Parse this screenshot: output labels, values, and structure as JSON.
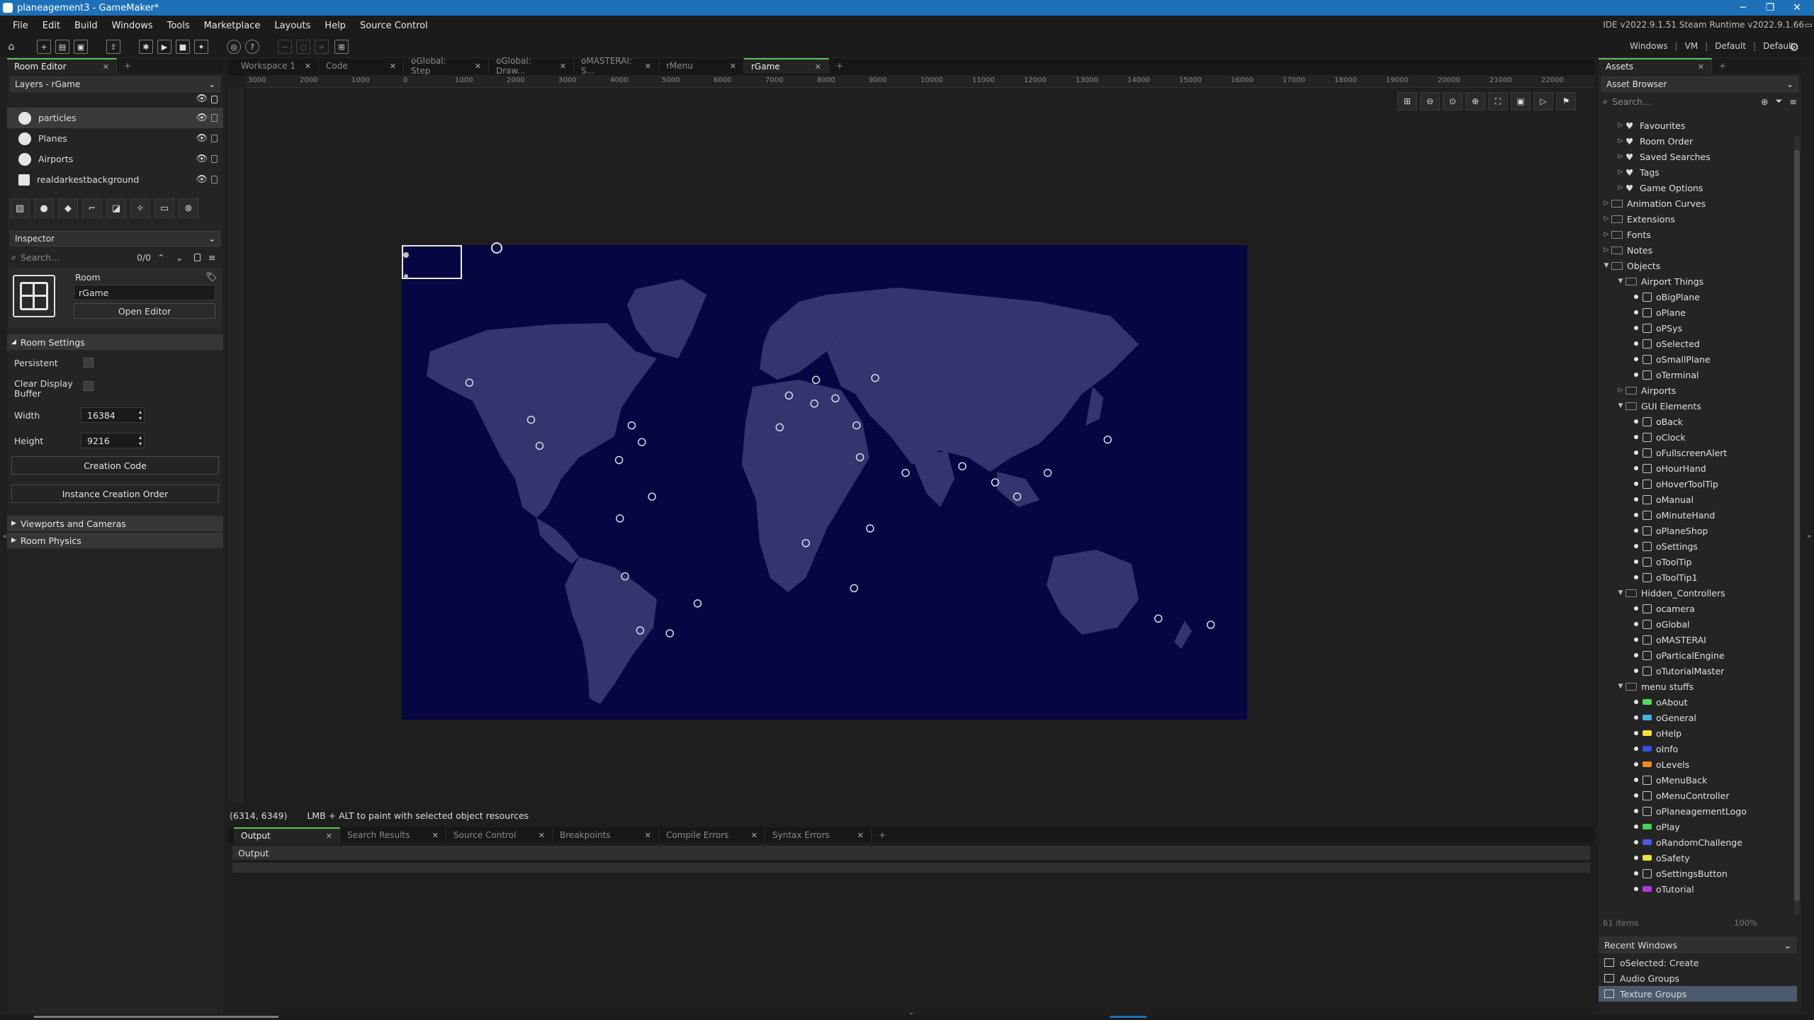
{
  "window": {
    "title": "planeagement3 - GameMaker*"
  },
  "menu": [
    "File",
    "Edit",
    "Build",
    "Windows",
    "Tools",
    "Marketplace",
    "Layouts",
    "Help",
    "Source Control"
  ],
  "ide_version": "IDE v2022.9.1.51 Steam  Runtime v2022.9.1.66",
  "toolbar_right": {
    "platform": "Windows",
    "target": "VM",
    "config": "Default",
    "device": "Default"
  },
  "left": {
    "tab": "Room Editor",
    "layers_dropdown": "Layers - rGame",
    "layers": [
      "particles",
      "Planes",
      "Airports",
      "realdarkestbackground"
    ],
    "inspector_dropdown": "Inspector",
    "search_placeholder": "Search...",
    "search_count": "0/0",
    "room_label": "Room",
    "room_name": "rGame",
    "open_editor": "Open Editor",
    "room_settings": "Room Settings",
    "persistent": "Persistent",
    "clear_display": "Clear Display",
    "clear_display2": "Buffer",
    "width_label": "Width",
    "width_value": "16384",
    "height_label": "Height",
    "height_value": "9216",
    "creation_code": "Creation Code",
    "instance_order": "Instance Creation Order",
    "viewports": "Viewports and Cameras",
    "physics": "Room Physics"
  },
  "doc_tabs": [
    "Workspace 1",
    "Code",
    "oGlobal: Step",
    "oGlobal: Draw...",
    "oMASTERAI: S...",
    "rMenu",
    "rGame"
  ],
  "ruler_labels": [
    "3000",
    "2000",
    "1000",
    "0",
    "1000",
    "2000",
    "3000",
    "4000",
    "5000",
    "6000",
    "7000",
    "8000",
    "9000",
    "10000",
    "11000",
    "12000",
    "13000",
    "14000",
    "15000",
    "16000",
    "17000",
    "18000",
    "19000",
    "20000",
    "21000",
    "22000"
  ],
  "status": {
    "coords": "(6314, 6349)",
    "hint": "LMB + ALT to paint with selected object resources"
  },
  "output_tabs": [
    "Output",
    "Search Results",
    "Source Control",
    "Breakpoints",
    "Compile Errors",
    "Syntax Errors"
  ],
  "output_title": "Output",
  "assets": {
    "tab": "Assets",
    "browser": "Asset Browser",
    "search_placeholder": "Search...",
    "tree": [
      {
        "label": "Favourites",
        "level": 1,
        "kind": "fav"
      },
      {
        "label": "Room Order",
        "level": 1,
        "kind": "fav"
      },
      {
        "label": "Saved Searches",
        "level": 1,
        "kind": "fav"
      },
      {
        "label": "Tags",
        "level": 1,
        "kind": "fav"
      },
      {
        "label": "Game Options",
        "level": 1,
        "kind": "fav"
      },
      {
        "label": "Animation Curves",
        "level": 0,
        "kind": "folder"
      },
      {
        "label": "Extensions",
        "level": 0,
        "kind": "folder"
      },
      {
        "label": "Fonts",
        "level": 0,
        "kind": "folder"
      },
      {
        "label": "Notes",
        "level": 0,
        "kind": "folder"
      },
      {
        "label": "Objects",
        "level": 0,
        "kind": "folder-open"
      },
      {
        "label": "Airport Things",
        "level": 1,
        "kind": "folder-open"
      },
      {
        "label": "oBigPlane",
        "level": 2,
        "kind": "obj"
      },
      {
        "label": "oPlane",
        "level": 2,
        "kind": "obj"
      },
      {
        "label": "oPSys",
        "level": 2,
        "kind": "obj"
      },
      {
        "label": "oSelected",
        "level": 2,
        "kind": "obj"
      },
      {
        "label": "oSmallPlane",
        "level": 2,
        "kind": "obj"
      },
      {
        "label": "oTerminal",
        "level": 2,
        "kind": "obj"
      },
      {
        "label": "Airports",
        "level": 1,
        "kind": "folder"
      },
      {
        "label": "GUI Elements",
        "level": 1,
        "kind": "folder-open"
      },
      {
        "label": "oBack",
        "level": 2,
        "kind": "obj"
      },
      {
        "label": "oClock",
        "level": 2,
        "kind": "obj"
      },
      {
        "label": "oFullscreenAlert",
        "level": 2,
        "kind": "obj"
      },
      {
        "label": "oHourHand",
        "level": 2,
        "kind": "obj"
      },
      {
        "label": "oHoverToolTip",
        "level": 2,
        "kind": "obj"
      },
      {
        "label": "oManual",
        "level": 2,
        "kind": "obj"
      },
      {
        "label": "oMinuteHand",
        "level": 2,
        "kind": "obj"
      },
      {
        "label": "oPlaneShop",
        "level": 2,
        "kind": "obj"
      },
      {
        "label": "oSettings",
        "level": 2,
        "kind": "obj"
      },
      {
        "label": "oToolTip",
        "level": 2,
        "kind": "obj"
      },
      {
        "label": "oToolTip1",
        "level": 2,
        "kind": "obj"
      },
      {
        "label": "Hidden_Controllers",
        "level": 1,
        "kind": "folder-open"
      },
      {
        "label": "ocamera",
        "level": 2,
        "kind": "obj"
      },
      {
        "label": "oGlobal",
        "level": 2,
        "kind": "obj"
      },
      {
        "label": "oMASTERAI",
        "level": 2,
        "kind": "obj"
      },
      {
        "label": "oParticalEngine",
        "level": 2,
        "kind": "obj"
      },
      {
        "label": "oTutorialMaster",
        "level": 2,
        "kind": "obj"
      },
      {
        "label": "menu stuffs",
        "level": 1,
        "kind": "folder-open"
      },
      {
        "label": "oAbout",
        "level": 2,
        "kind": "obj",
        "color": "#5bd75b"
      },
      {
        "label": "oGeneral",
        "level": 2,
        "kind": "obj",
        "color": "#3fb6e0"
      },
      {
        "label": "oHelp",
        "level": 2,
        "kind": "obj",
        "color": "#f3e23a"
      },
      {
        "label": "oInfo",
        "level": 2,
        "kind": "obj",
        "color": "#3a4de0"
      },
      {
        "label": "oLevels",
        "level": 2,
        "kind": "obj",
        "color": "#f08a24"
      },
      {
        "label": "oMenuBack",
        "level": 2,
        "kind": "obj"
      },
      {
        "label": "oMenuController",
        "level": 2,
        "kind": "obj"
      },
      {
        "label": "oPlaneagementLogo",
        "level": 2,
        "kind": "obj"
      },
      {
        "label": "oPlay",
        "level": 2,
        "kind": "obj",
        "color": "#4ad04a"
      },
      {
        "label": "oRandomChallenge",
        "level": 2,
        "kind": "obj",
        "color": "#4a5ae0"
      },
      {
        "label": "oSafety",
        "level": 2,
        "kind": "obj",
        "color": "#f0e03a"
      },
      {
        "label": "oSettingsButton",
        "level": 2,
        "kind": "obj"
      },
      {
        "label": "oTutorial",
        "level": 2,
        "kind": "obj",
        "color": "#b03ad0"
      }
    ],
    "footer_count": "61 items",
    "footer_zoom": "100%",
    "recent": "Recent Windows",
    "recent_items": [
      "oSelected: Create",
      "Audio Groups",
      "Texture Groups"
    ]
  },
  "map": {
    "ocean": "#060642",
    "land": "#34346e",
    "airports": [
      [
        0.08,
        0.29
      ],
      [
        0.153,
        0.368
      ],
      [
        0.163,
        0.423
      ],
      [
        0.272,
        0.38
      ],
      [
        0.284,
        0.415
      ],
      [
        0.257,
        0.453
      ],
      [
        0.296,
        0.53
      ],
      [
        0.258,
        0.576
      ],
      [
        0.264,
        0.698
      ],
      [
        0.282,
        0.812
      ],
      [
        0.317,
        0.818
      ],
      [
        0.35,
        0.755
      ],
      [
        0.447,
        0.384
      ],
      [
        0.458,
        0.317
      ],
      [
        0.49,
        0.284
      ],
      [
        0.488,
        0.334
      ],
      [
        0.513,
        0.323
      ],
      [
        0.56,
        0.28
      ],
      [
        0.538,
        0.38
      ],
      [
        0.542,
        0.447
      ],
      [
        0.554,
        0.597
      ],
      [
        0.596,
        0.48
      ],
      [
        0.663,
        0.466
      ],
      [
        0.702,
        0.5
      ],
      [
        0.728,
        0.53
      ],
      [
        0.764,
        0.48
      ],
      [
        0.835,
        0.41
      ],
      [
        0.478,
        0.628
      ],
      [
        0.535,
        0.723
      ],
      [
        0.895,
        0.787
      ],
      [
        0.957,
        0.8
      ]
    ]
  }
}
